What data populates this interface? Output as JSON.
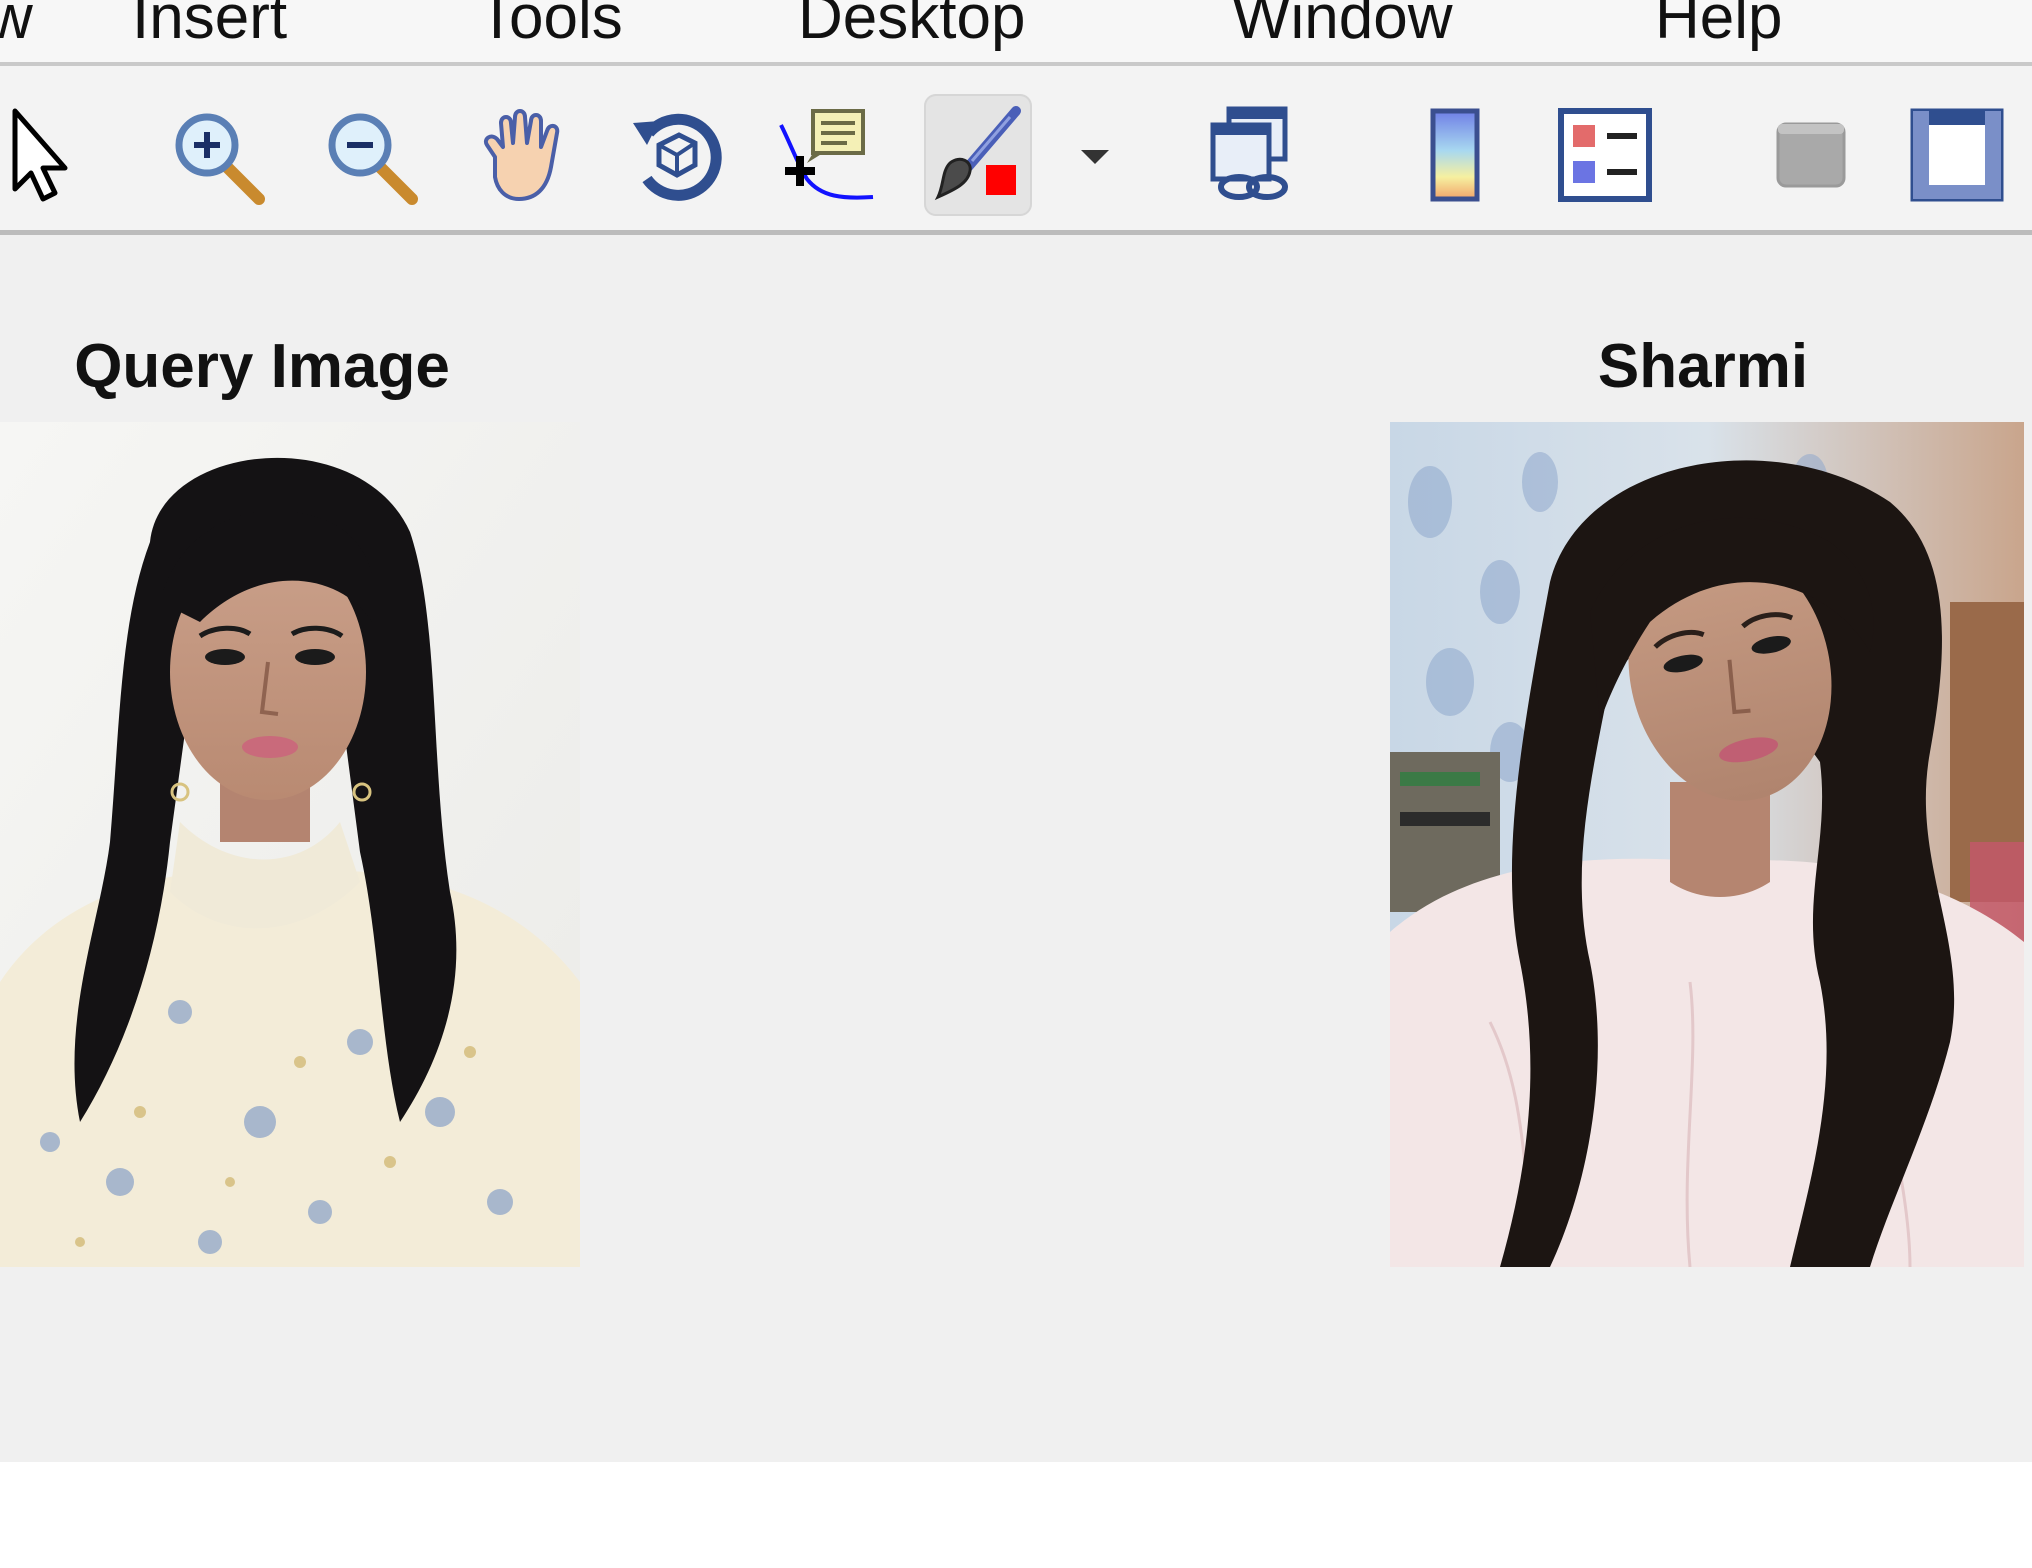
{
  "menubar": {
    "items": [
      {
        "label": "w"
      },
      {
        "label": "Insert"
      },
      {
        "label": "Tools"
      },
      {
        "label": "Desktop"
      },
      {
        "label": "Window"
      },
      {
        "label": "Help"
      }
    ]
  },
  "toolbar": {
    "buttons": [
      {
        "icon": "arrow-pointer-icon"
      },
      {
        "icon": "zoom-in-icon"
      },
      {
        "icon": "zoom-out-icon"
      },
      {
        "icon": "pan-hand-icon"
      },
      {
        "icon": "rotate-3d-icon"
      },
      {
        "icon": "data-cursor-icon"
      },
      {
        "icon": "brush-icon",
        "state": "pressed"
      },
      {
        "icon": "dropdown-arrow-icon"
      },
      {
        "icon": "link-plot-icon"
      },
      {
        "icon": "colorbar-icon"
      },
      {
        "icon": "legend-icon"
      },
      {
        "icon": "hide-plot-tools-icon"
      },
      {
        "icon": "show-plot-tools-icon"
      }
    ]
  },
  "figure": {
    "left_axes": {
      "title": "Query Image"
    },
    "right_axes": {
      "title": "Sharmi"
    }
  },
  "colors": {
    "menubar_bg": "#f7f7f7",
    "toolbar_bg": "#f3f3f3",
    "canvas_bg": "#f0f0f0",
    "brush_red": "#ff0000",
    "icon_blue": "#2b4f9a"
  }
}
